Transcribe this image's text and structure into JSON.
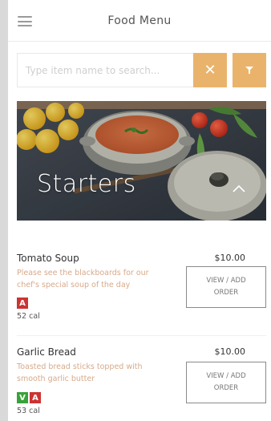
{
  "header": {
    "title": "Food Menu",
    "menu_icon": "hamburger-menu-icon"
  },
  "search": {
    "placeholder": "Type item name to search...",
    "value": "",
    "clear_icon": "close-icon",
    "filter_icon": "filter-icon"
  },
  "colors": {
    "accent": "#eab36c",
    "allergen_badge": "#cc3333",
    "vegetarian_badge": "#3aa23a",
    "description_text": "#d7a98a"
  },
  "section": {
    "title": "Starters",
    "toggle_icon": "chevron-up-icon"
  },
  "items": [
    {
      "name": "Tomato Soup",
      "price": "$10.00",
      "description": "Please see the blackboards for our chef's special soup of the day",
      "badges": [
        "A"
      ],
      "calories": "52 cal",
      "order_label": "VIEW / ADD ORDER"
    },
    {
      "name": "Garlic Bread",
      "price": "$10.00",
      "description": "Toasted bread sticks topped with smooth garlic butter",
      "badges": [
        "V",
        "A"
      ],
      "calories": "53 cal",
      "order_label": "VIEW / ADD ORDER"
    }
  ]
}
